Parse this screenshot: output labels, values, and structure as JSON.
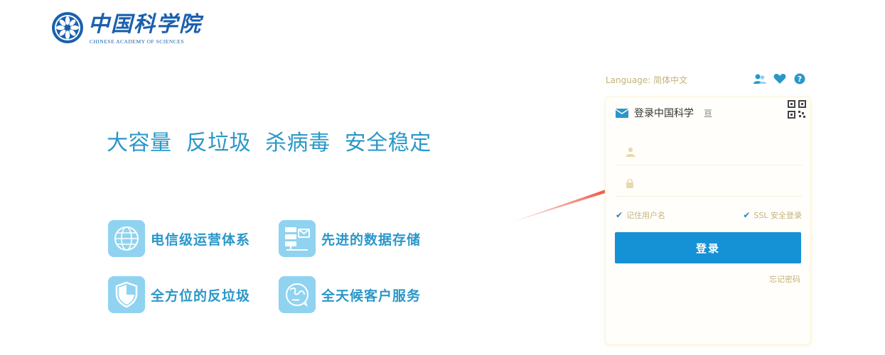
{
  "logo": {
    "title_cn": "中国科学院",
    "title_en": "CHINESE ACADEMY OF SCIENCES",
    "color": "#1a5fae"
  },
  "slogan": "大容量  反垃圾  杀病毒  安全稳定",
  "features": [
    {
      "label": "电信级运营体系",
      "icon": "globe-icon"
    },
    {
      "label": "先进的数据存储",
      "icon": "data-storage-icon"
    },
    {
      "label": "全方位的反垃圾",
      "icon": "shield-icon"
    },
    {
      "label": "全天候客户服务",
      "icon": "customer-service-globe-icon"
    }
  ],
  "language": {
    "label": "Language: 简体中文"
  },
  "top_icons": [
    "contacts-icon",
    "heart-icon",
    "help-icon"
  ],
  "login": {
    "title": "登录中国科学",
    "title_suffix": "亘",
    "username_placeholder": "",
    "password_placeholder": "",
    "remember_label": "记住用户名",
    "ssl_label": "SSL 安全登录",
    "submit_label": "登录",
    "forgot_label": "忘记密码"
  },
  "colors": {
    "accent": "#2a97c9",
    "button": "#1591d6",
    "feature_icon_bg": "#8fd3f0",
    "muted_text": "#c3b37a",
    "arrow": "#e8321e"
  }
}
